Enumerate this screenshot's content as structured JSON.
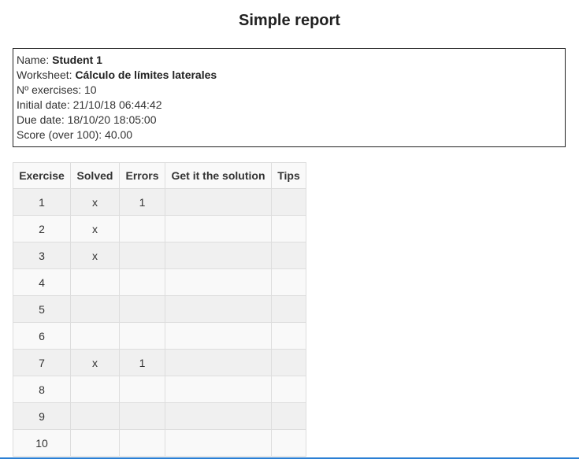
{
  "page": {
    "title": "Simple report"
  },
  "info": {
    "name_label": "Name: ",
    "name_value": "Student 1",
    "worksheet_label": "Worksheet: ",
    "worksheet_value": "Cálculo de límites laterales",
    "exercises_text": "Nº exercises: 10",
    "initial_date_text": "Initial date: 21/10/18 06:44:42",
    "due_date_text": "Due date: 18/10/20 18:05:00",
    "score_text": "Score (over 100): 40.00"
  },
  "table": {
    "headers": [
      "Exercise",
      "Solved",
      "Errors",
      "Get it the solution",
      "Tips"
    ],
    "rows": [
      {
        "exercise": "1",
        "solved": "x",
        "errors": "1",
        "solution": "",
        "tips": ""
      },
      {
        "exercise": "2",
        "solved": "x",
        "errors": "",
        "solution": "",
        "tips": ""
      },
      {
        "exercise": "3",
        "solved": "x",
        "errors": "",
        "solution": "",
        "tips": ""
      },
      {
        "exercise": "4",
        "solved": "",
        "errors": "",
        "solution": "",
        "tips": ""
      },
      {
        "exercise": "5",
        "solved": "",
        "errors": "",
        "solution": "",
        "tips": ""
      },
      {
        "exercise": "6",
        "solved": "",
        "errors": "",
        "solution": "",
        "tips": ""
      },
      {
        "exercise": "7",
        "solved": "x",
        "errors": "1",
        "solution": "",
        "tips": ""
      },
      {
        "exercise": "8",
        "solved": "",
        "errors": "",
        "solution": "",
        "tips": ""
      },
      {
        "exercise": "9",
        "solved": "",
        "errors": "",
        "solution": "",
        "tips": ""
      },
      {
        "exercise": "10",
        "solved": "",
        "errors": "",
        "solution": "",
        "tips": ""
      }
    ]
  }
}
